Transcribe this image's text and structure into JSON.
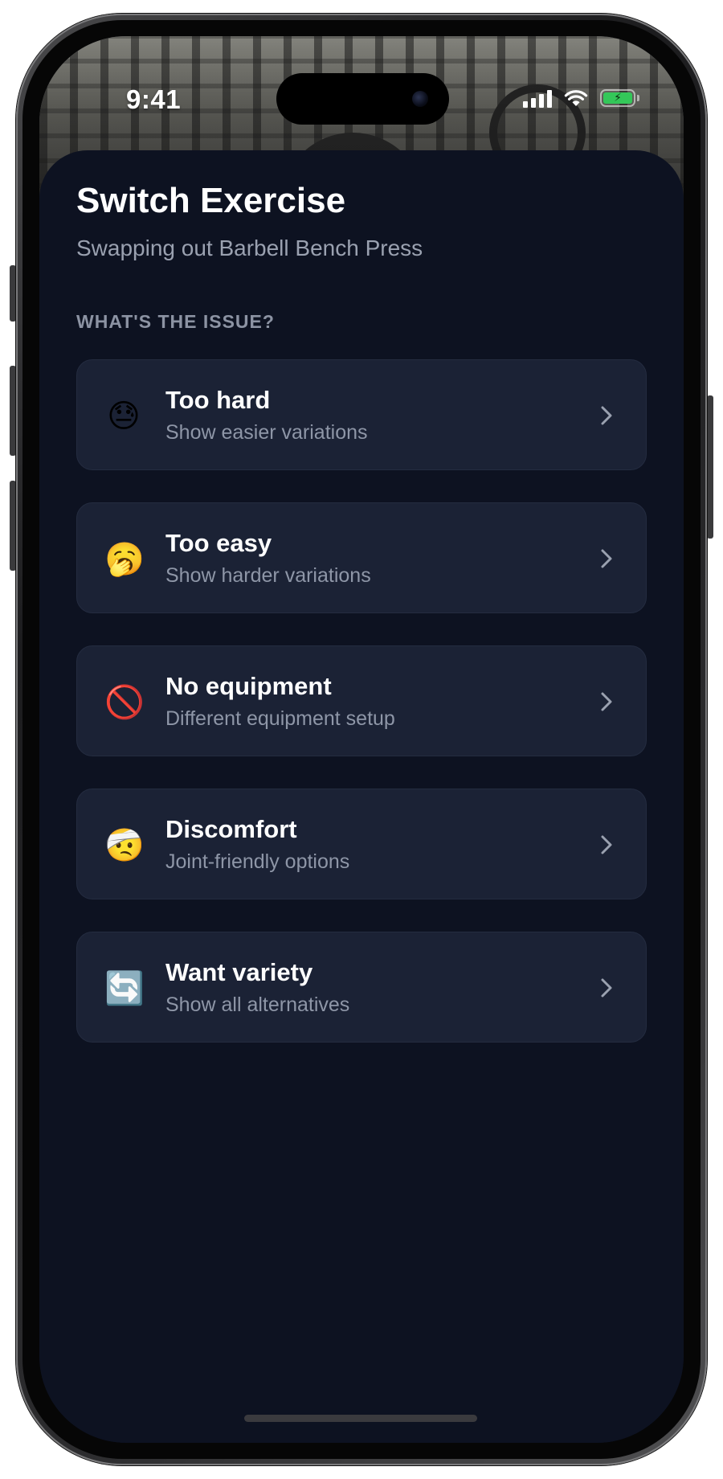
{
  "status_bar": {
    "time": "9:41",
    "icons": [
      "signal-icon",
      "wifi-icon",
      "battery-charging-icon"
    ],
    "battery_color": "#34c759"
  },
  "sheet": {
    "title": "Switch Exercise",
    "subtitle": "Swapping out Barbell Bench Press",
    "section_label": "WHAT'S THE ISSUE?"
  },
  "options": [
    {
      "emoji": "😓",
      "icon": "downcast-sweat-face-icon",
      "title": "Too hard",
      "subtitle": "Show easier variations"
    },
    {
      "emoji": "🥱",
      "icon": "yawning-face-icon",
      "title": "Too easy",
      "subtitle": "Show harder variations"
    },
    {
      "emoji": "🚫",
      "icon": "prohibited-icon",
      "title": "No equipment",
      "subtitle": "Different equipment setup"
    },
    {
      "emoji": "🤕",
      "icon": "bandaged-face-icon",
      "title": "Discomfort",
      "subtitle": "Joint-friendly options"
    },
    {
      "emoji": "🔄",
      "icon": "refresh-arrows-icon",
      "title": "Want variety",
      "subtitle": "Show all alternatives"
    }
  ],
  "colors": {
    "sheet_background": "#0d1221",
    "card_background": "#1b2235",
    "title_text": "#ffffff",
    "secondary_text": "#9aa1b0",
    "chevron": "#9aa1b0"
  }
}
